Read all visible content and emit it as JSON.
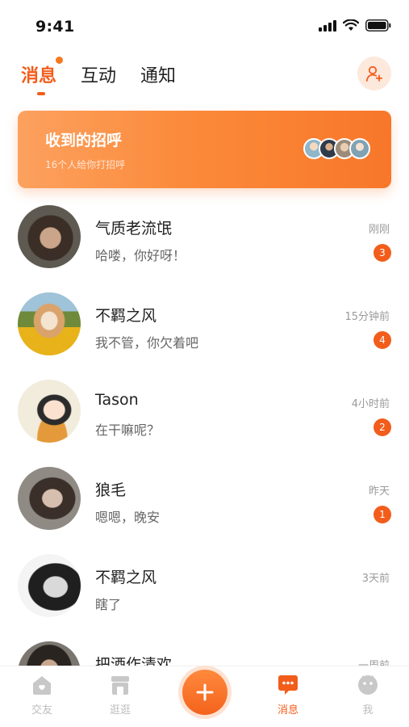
{
  "status_bar": {
    "time": "9:41"
  },
  "top_tabs": [
    {
      "label": "消息",
      "active": true,
      "has_dot": true
    },
    {
      "label": "互动",
      "active": false
    },
    {
      "label": "通知",
      "active": false
    }
  ],
  "add_friend_icon": "add-user-icon",
  "greeting": {
    "title": "收到的招呼",
    "subtitle": "16个人给你打招呼"
  },
  "conversations": [
    {
      "name": "气质老流氓",
      "preview": "哈喽，你好呀！",
      "time": "刚刚",
      "badge": "3"
    },
    {
      "name": "不羁之风",
      "preview": "我不管，你欠着吧",
      "time": "15分钟前",
      "badge": "4"
    },
    {
      "name": "Tason",
      "preview": "在干嘛呢？",
      "time": "4小时前",
      "badge": "2"
    },
    {
      "name": "狼毛",
      "preview": "嗯嗯，晚安",
      "time": "昨天",
      "badge": "1"
    },
    {
      "name": "不羁之风",
      "preview": "瞎了",
      "time": "3天前",
      "badge": ""
    },
    {
      "name": "把酒作清欢",
      "preview": "",
      "time": "一周前",
      "badge": ""
    }
  ],
  "bottom_nav": [
    {
      "label": "交友",
      "icon": "home-icon",
      "active": false
    },
    {
      "label": "逛逛",
      "icon": "shop-icon",
      "active": false
    },
    {
      "label": "消息",
      "icon": "chat-bubble-icon",
      "active": true
    },
    {
      "label": "我",
      "icon": "profile-face-icon",
      "active": false
    }
  ],
  "colors": {
    "accent": "#f25d1c",
    "banner_start": "#fca15f",
    "banner_end": "#f8772a",
    "inactive_nav": "#bdbdbd"
  }
}
